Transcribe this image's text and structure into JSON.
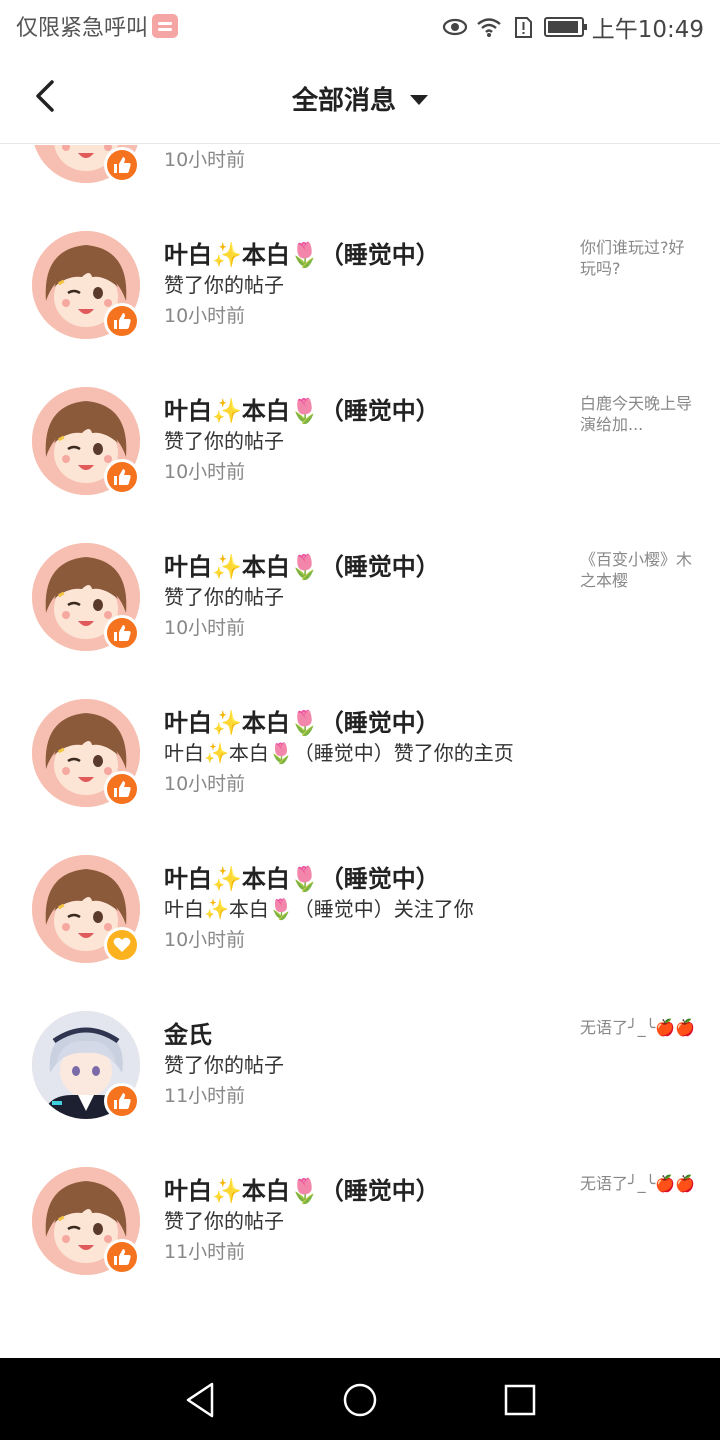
{
  "status_bar": {
    "carrier": "仅限紧急呼叫",
    "time": "上午10:49",
    "icons": [
      "eye-icon",
      "wifi-icon",
      "sim-alert-icon",
      "battery-icon"
    ]
  },
  "header": {
    "title": "全部消息",
    "back_icon": "chevron-left-icon",
    "dropdown_icon": "caret-down-icon"
  },
  "messages": [
    {
      "name": "",
      "action": "赞了你的帖子",
      "time": "10小时前",
      "preview": "",
      "type": "like"
    },
    {
      "name": "叶白✨本白🌷（睡觉中）",
      "action": "赞了你的帖子",
      "time": "10小时前",
      "preview": "你们谁玩过?好玩吗?",
      "type": "like"
    },
    {
      "name": "叶白✨本白🌷（睡觉中）",
      "action": "赞了你的帖子",
      "time": "10小时前",
      "preview": "白鹿今天晚上导演给加...",
      "type": "like"
    },
    {
      "name": "叶白✨本白🌷（睡觉中）",
      "action": "赞了你的帖子",
      "time": "10小时前",
      "preview": "《百变小樱》木之本樱",
      "type": "like"
    },
    {
      "name": "叶白✨本白🌷（睡觉中）",
      "action": "叶白✨本白🌷（睡觉中）赞了你的主页",
      "time": "10小时前",
      "preview": "",
      "type": "like"
    },
    {
      "name": "叶白✨本白🌷（睡觉中）",
      "action": "叶白✨本白🌷（睡觉中）关注了你",
      "time": "10小时前",
      "preview": "",
      "type": "follow"
    },
    {
      "name": "金氏",
      "action": "赞了你的帖子",
      "time": "11小时前",
      "preview": "无语了╯_╰🍎🍎",
      "type": "like"
    },
    {
      "name": "叶白✨本白🌷（睡觉中）",
      "action": "赞了你的帖子",
      "time": "11小时前",
      "preview": "无语了╯_╰🍎🍎",
      "type": "like"
    }
  ],
  "colors": {
    "like_badge": "#f5731e",
    "follow_badge": "#fbb21e",
    "avatar_bg": "#f8c4b7"
  },
  "nav_bar": {
    "icons": [
      "back-triangle-icon",
      "home-circle-icon",
      "recents-square-icon"
    ]
  }
}
